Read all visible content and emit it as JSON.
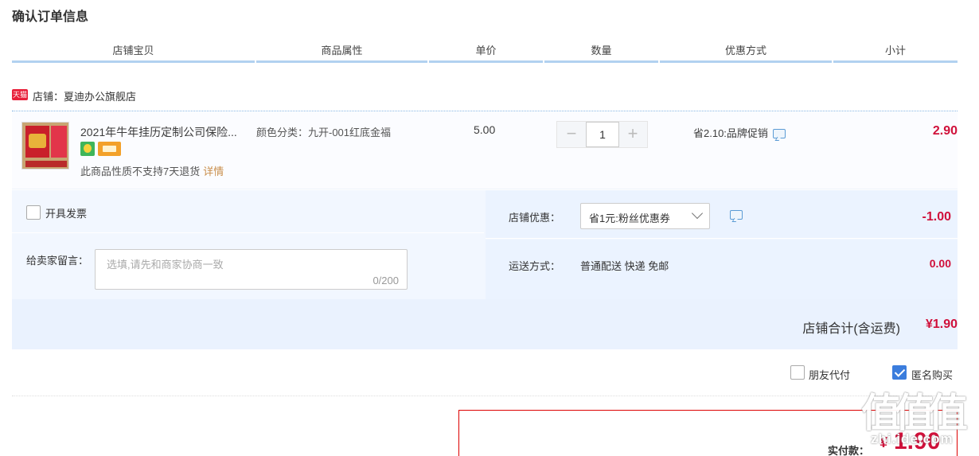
{
  "page": {
    "title": "确认订单信息"
  },
  "columns": [
    {
      "label": "店铺宝贝"
    },
    {
      "label": "商品属性"
    },
    {
      "label": "单价"
    },
    {
      "label": "数量"
    },
    {
      "label": "优惠方式"
    },
    {
      "label": "小计"
    }
  ],
  "shop": {
    "badge": "天猫",
    "label": "店铺：夏迪办公旗舰店"
  },
  "item": {
    "title": "2021年牛年挂历定制公司保险...",
    "attr": "颜色分类：九开-001红底金福",
    "unit_price": "5.00",
    "quantity": "1",
    "minus": "−",
    "plus": "+",
    "promo": "省2.10:品牌促销",
    "subtotal": "2.90",
    "no_return": "此商品性质不支持7天退货",
    "detail_link": "详情"
  },
  "extras": {
    "invoice_label": "开具发票",
    "message_label": "给卖家留言：",
    "message_placeholder": "选填,请先和商家协商一致",
    "message_count": "0/200",
    "shop_discount_label": "店铺优惠：",
    "shop_discount_value": "省1元:粉丝优惠券",
    "shop_discount_amount": "-1.00",
    "shipping_label": "运送方式：",
    "shipping_value": "普通配送 快递 免邮",
    "shipping_amount": "0.00",
    "shop_total_label": "店铺合计(含运费)",
    "shop_total_value": "¥1.90"
  },
  "options": {
    "friend_pay_label": "朋友代付",
    "friend_pay_checked": false,
    "anonymous_label": "匿名购买",
    "anonymous_checked": true
  },
  "payment": {
    "label": "实付款：",
    "currency": "¥",
    "amount": "1.90"
  },
  "watermark": {
    "text": "值值值",
    "sub": "zhi.ide.com"
  },
  "colors": {
    "price_red": "#d0103a",
    "header_rule": "#b2d1f0",
    "panel_bg": "#f2f7ff",
    "accent_blue": "#3b7ddd"
  }
}
